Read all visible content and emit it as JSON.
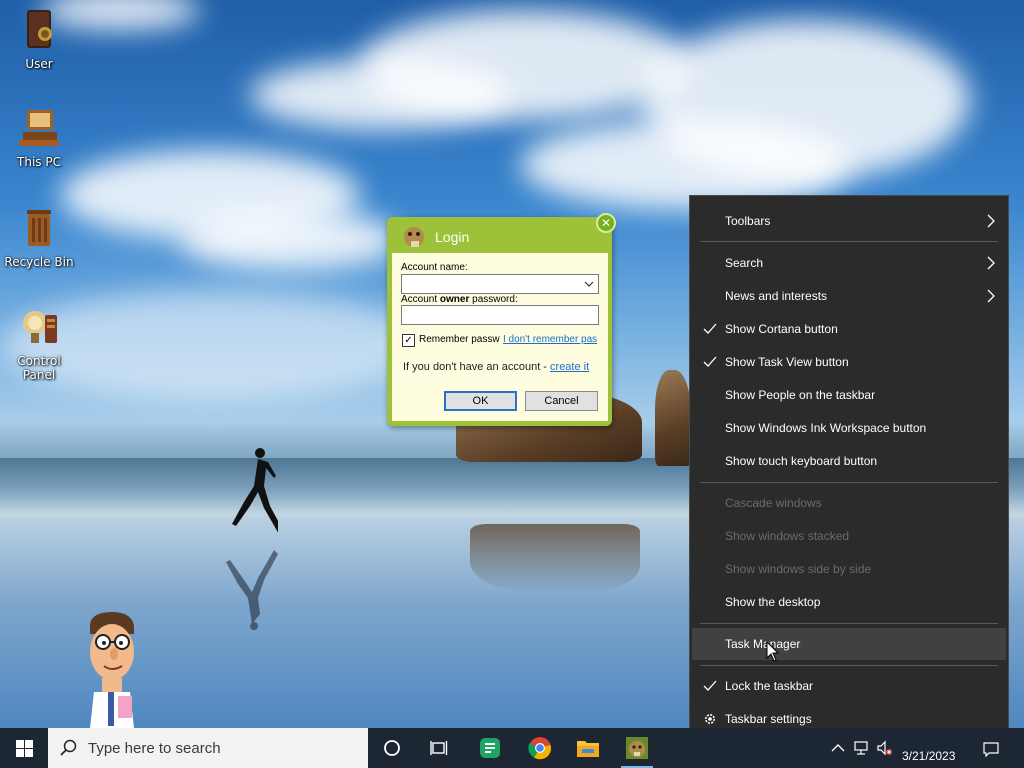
{
  "desktop": {
    "icons": [
      {
        "label": "User",
        "icon": "book-icon"
      },
      {
        "label": "This PC",
        "icon": "computer-icon"
      },
      {
        "label": "Recycle Bin",
        "icon": "recycle-bin-icon"
      },
      {
        "label": "Control Panel",
        "icon": "control-panel-icon"
      }
    ]
  },
  "login": {
    "title": "Login",
    "account_name_label": "Account name:",
    "account_name_value": "",
    "password_label_pre": "Account ",
    "password_label_bold": "owner",
    "password_label_post": " password:",
    "password_value": "",
    "remember_checked": true,
    "remember_label": "Remember passw",
    "forgot_link": "I don't remember pas",
    "no_account_text": "If you don't have an account - ",
    "create_link": "create it",
    "ok_label": "OK",
    "cancel_label": "Cancel"
  },
  "context_menu": {
    "items": [
      {
        "label": "Toolbars",
        "submenu": true
      },
      {
        "label": "Search",
        "submenu": true
      },
      {
        "label": "News and interests",
        "submenu": true
      },
      {
        "label": "Show Cortana button",
        "checked": true
      },
      {
        "label": "Show Task View button",
        "checked": true
      },
      {
        "label": "Show People on the taskbar"
      },
      {
        "label": "Show Windows Ink Workspace button"
      },
      {
        "label": "Show touch keyboard button"
      },
      {
        "label": "Cascade windows",
        "disabled": true
      },
      {
        "label": "Show windows stacked",
        "disabled": true
      },
      {
        "label": "Show windows side by side",
        "disabled": true
      },
      {
        "label": "Show the desktop"
      },
      {
        "label": "Task Manager",
        "hovered": true
      },
      {
        "label": "Lock the taskbar",
        "checked": true
      },
      {
        "label": "Taskbar settings",
        "icon": "gear-icon"
      }
    ]
  },
  "taskbar": {
    "search_placeholder": "Type here to search",
    "date": "3/21/2023",
    "apps": [
      "cortana-icon",
      "task-view-icon",
      "sheets-icon",
      "chrome-icon",
      "file-explorer-icon",
      "login-app-icon"
    ]
  },
  "colors": {
    "login_frame": "#9dc23a",
    "login_body": "#fffde0",
    "menu_bg": "#2b2b2b",
    "taskbar_bg": "#1c2733"
  }
}
